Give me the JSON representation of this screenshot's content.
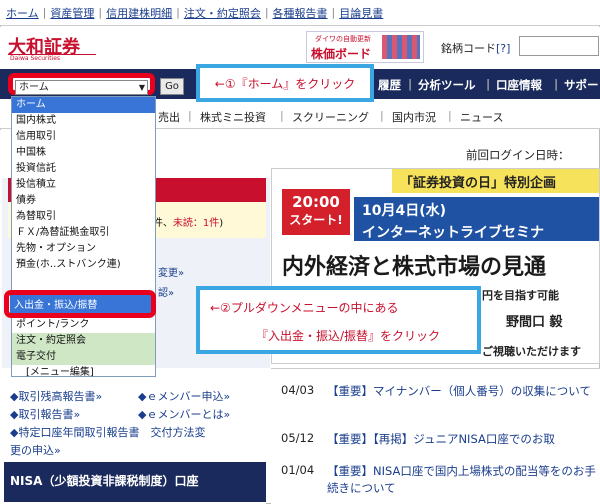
{
  "top_links": [
    "ホーム",
    "資産管理",
    "信用建株明細",
    "注文・約定照会",
    "各種報告書",
    "目論見書"
  ],
  "header": {
    "logo": "大和証券",
    "logo_sub": "Daiwa Securities",
    "kabuka_small": "ダイワの自動更新",
    "kabuka_big": "株価ボード",
    "code_label": "銘柄コード",
    "code_help": "[?]"
  },
  "nav": {
    "items": [
      "履歴",
      "分析ツール",
      "口座情報",
      "サポー"
    ]
  },
  "subnav": {
    "items": [
      "売出",
      "株式ミニ投資",
      "スクリーニング",
      "国内市況",
      "ニュース"
    ]
  },
  "select": {
    "value": "ホーム",
    "go": "Go"
  },
  "dropdown": {
    "items": [
      "ホーム",
      "国内株式",
      "信用取引",
      "中国株",
      "投資信託",
      "投信積立",
      "債券",
      "為替取引",
      "ＦＸ/為替証拠金取引",
      "先物・オプション",
      "預金(ホ..ストバンク連)",
      "入出金・振込/振替",
      "ポイント/ランク",
      "注文・約定照会",
      "電子交付",
      "[メニュー編集]"
    ]
  },
  "callouts": {
    "c1": "←①『ホーム』をクリック",
    "c2_line1": "←②プルダウンメニューの中にある",
    "c2_line2": "『入出金・振込/振替』をクリック"
  },
  "left": {
    "unread_prefix": ": 1件、",
    "unread_red": "未読：1件",
    "unread_suffix": ")",
    "change": "変更»",
    "confirm": "認»",
    "links": [
      "◆取引残高報告書»",
      "◆ｅメンバー申込»",
      "◆取引報告書»",
      "◆ｅメンバーとは»",
      "◆特定口座年間取引報告書　交付方法変",
      "更の申込»"
    ],
    "nisa": "NISA（少額投資非課税制度）口座"
  },
  "right": {
    "login": "前回ログイン日時：",
    "banner_strip_pre": "「証券投資の日」特別企画",
    "start_time": "20:00",
    "start_label": "スタート!",
    "date_line": "10月4日(水)",
    "date_line2": "インターネットライブセミナ",
    "title": "内外経済と株式市場の見通",
    "sub1": "円を目指す可能",
    "sub2": "野間口 毅",
    "sub3": "ご視聴いただけます"
  },
  "news": [
    {
      "date": "04/03",
      "text": "【重要】マイナンバー（個人番号）の収集について"
    },
    {
      "date": "05/12",
      "text": "【重要】【再掲】ジュニアNISA口座でのお取"
    },
    {
      "date": "01/04",
      "text": "【重要】NISA口座で国内上場株式の配当等をのお手続きについて"
    }
  ]
}
